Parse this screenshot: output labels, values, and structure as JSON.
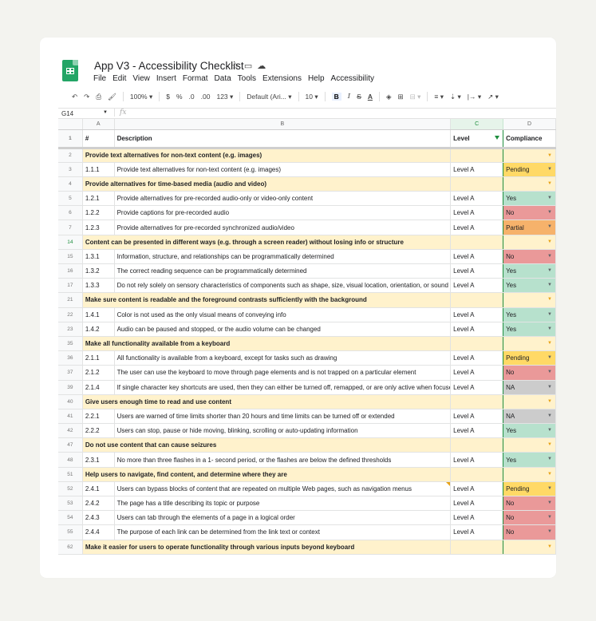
{
  "doc": {
    "title": "App V3 - Accessibility  Checklist",
    "menu": [
      "File",
      "Edit",
      "View",
      "Insert",
      "Format",
      "Data",
      "Tools",
      "Extensions",
      "Help",
      "Accessibility"
    ]
  },
  "toolbar": {
    "zoom": "100%",
    "currency": "$",
    "percent": "%",
    "dec_decrease": ".0",
    "dec_increase": ".00",
    "format_more": "123",
    "font": "Default (Ari...",
    "font_size": "10",
    "bold": "B",
    "italic": "I",
    "strike": "S",
    "text_color": "A"
  },
  "formula_bar": {
    "cell_ref": "G14",
    "fx": "fx"
  },
  "columns": {
    "a": "A",
    "b": "B",
    "c": "C",
    "d": "D"
  },
  "header_row": {
    "num": "1",
    "a": "#",
    "b": "Description",
    "c": "Level",
    "d": "Compliance"
  },
  "status_colors": {
    "Pending": "#ffd966",
    "Yes": "#b7e1cd",
    "No": "#ea9999",
    "Partial": "#f6b26b",
    "NA": "#cccccc"
  },
  "rows": [
    {
      "num": "2",
      "type": "section",
      "title": "Provide text alternatives for non-text content (e.g. images)"
    },
    {
      "num": "3",
      "id": "1.1.1",
      "desc": "Provide text alternatives for non-text content (e.g. images)",
      "level": "Level A",
      "status": "Pending"
    },
    {
      "num": "4",
      "type": "section",
      "title": "Provide alternatives for time-based media (audio and video)"
    },
    {
      "num": "5",
      "id": "1.2.1",
      "desc": "Provide alternatives for pre-recorded audio-only or video-only content",
      "level": "Level A",
      "status": "Yes"
    },
    {
      "num": "6",
      "id": "1.2.2",
      "desc": "Provide captions for pre-recorded audio",
      "level": "Level A",
      "status": "No"
    },
    {
      "num": "7",
      "id": "1.2.3",
      "desc": "Provide alternatives for pre-recorded synchronized audio/video",
      "level": "Level A",
      "status": "Partial"
    },
    {
      "num": "14",
      "type": "section",
      "title": "Content can be presented in different ways (e.g. through a screen reader) without losing info or structure"
    },
    {
      "num": "15",
      "id": "1.3.1",
      "desc": "Information, structure, and relationships can be programmatically determined",
      "level": "Level A",
      "status": "No"
    },
    {
      "num": "16",
      "id": "1.3.2",
      "desc": "The correct reading sequence can be programmatically determined",
      "level": "Level A",
      "status": "Yes"
    },
    {
      "num": "17",
      "id": "1.3.3",
      "desc": "Do not rely solely on sensory characteristics of components such as shape, size, visual location, orientation, or sound",
      "level": "Level A",
      "status": "Yes"
    },
    {
      "num": "21",
      "type": "section",
      "title": "Make sure content is readable and the foreground contrasts sufficiently with the background"
    },
    {
      "num": "22",
      "id": "1.4.1",
      "desc": "Color is not used as the only visual means of conveying info",
      "level": "Level A",
      "status": "Yes"
    },
    {
      "num": "23",
      "id": "1.4.2",
      "desc": "Audio can be paused and stopped, or the audio volume can be changed",
      "level": "Level A",
      "status": "Yes"
    },
    {
      "num": "35",
      "type": "section",
      "title": "Make all functionality available from a keyboard"
    },
    {
      "num": "36",
      "id": "2.1.1",
      "desc": "All functionality is available from a keyboard, except for tasks such as drawing",
      "level": "Level A",
      "status": "Pending"
    },
    {
      "num": "37",
      "id": "2.1.2",
      "desc": "The user can use the keyboard to move through page elements and is not trapped on a particular element",
      "level": "Level A",
      "status": "No"
    },
    {
      "num": "39",
      "id": "2.1.4",
      "desc": "If single character key shortcuts are used, then they can either be turned off, remapped, or are only active when focused",
      "level": "Level A",
      "status": "NA"
    },
    {
      "num": "40",
      "type": "section",
      "title": "Give users enough time to read and use content"
    },
    {
      "num": "41",
      "id": "2.2.1",
      "desc": "Users are warned of time limits shorter than 20 hours and time limits can be turned off or extended",
      "level": "Level A",
      "status": "NA"
    },
    {
      "num": "42",
      "id": "2.2.2",
      "desc": "Users can stop, pause or hide moving, blinking, scrolling or auto-updating information",
      "level": "Level A",
      "status": "Yes"
    },
    {
      "num": "47",
      "type": "section",
      "title": "Do not use content that can cause seizures"
    },
    {
      "num": "48",
      "id": "2.3.1",
      "desc": "No more than three flashes in a 1- second period, or the flashes are below the defined thresholds",
      "level": "Level A",
      "status": "Yes"
    },
    {
      "num": "51",
      "type": "section",
      "title": "Help users to navigate, find content, and determine where they are"
    },
    {
      "num": "52",
      "id": "2.4.1",
      "desc": "Users can bypass blocks of content that are repeated on multiple Web pages, such as navigation menus",
      "level": "Level A",
      "status": "Pending"
    },
    {
      "num": "53",
      "id": "2.4.2",
      "desc": "The page has a title describing its topic or purpose",
      "level": "Level A",
      "status": "No"
    },
    {
      "num": "54",
      "id": "2.4.3",
      "desc": "Users can tab through the elements of a page in a logical order",
      "level": "Level A",
      "status": "No"
    },
    {
      "num": "55",
      "id": "2.4.4",
      "desc": "The purpose of each link can be determined from the link text or context",
      "level": "Level A",
      "status": "No"
    },
    {
      "num": "62",
      "type": "section",
      "title": "Make it easier for users to operate functionality through various inputs beyond keyboard"
    }
  ]
}
